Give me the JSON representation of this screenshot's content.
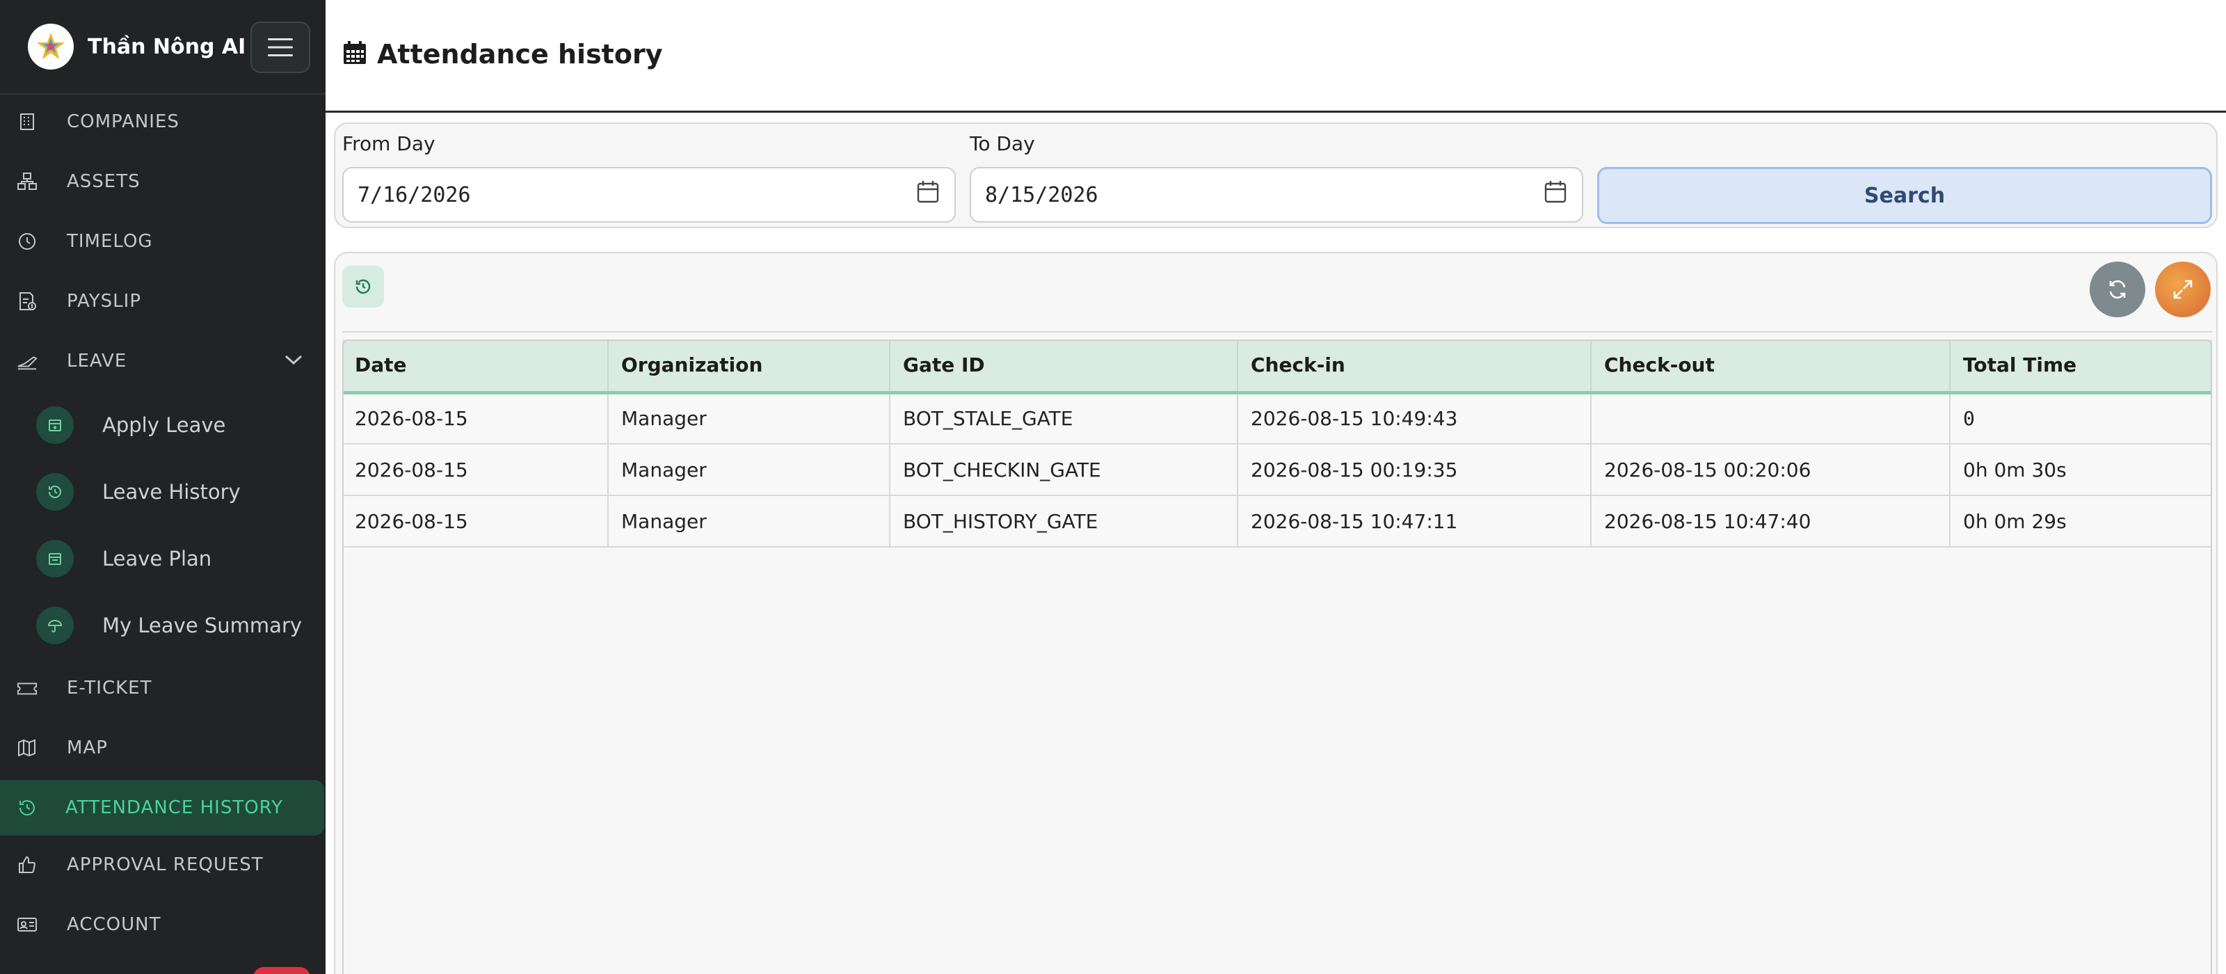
{
  "brand": {
    "name": "Thần Nông AI"
  },
  "sidebar": {
    "items": [
      {
        "label": "COMPANIES",
        "icon": "building-icon"
      },
      {
        "label": "ASSETS",
        "icon": "assets-icon"
      },
      {
        "label": "TIMELOG",
        "icon": "clock-icon"
      },
      {
        "label": "PAYSLIP",
        "icon": "payslip-icon"
      },
      {
        "label": "LEAVE",
        "icon": "leave-icon"
      },
      {
        "label": "E-TICKET",
        "icon": "ticket-icon"
      },
      {
        "label": "MAP",
        "icon": "map-icon"
      },
      {
        "label": "ATTENDANCE HISTORY",
        "icon": "history-icon"
      },
      {
        "label": "APPROVAL REQUEST",
        "icon": "thumbs-up-icon"
      },
      {
        "label": "ACCOUNT",
        "icon": "id-card-icon"
      }
    ],
    "leave_sub": [
      {
        "label": "Apply Leave",
        "icon": "calendar-plus-icon"
      },
      {
        "label": "Leave History",
        "icon": "history-icon"
      },
      {
        "label": "Leave Plan",
        "icon": "calendar-icon"
      },
      {
        "label": "My Leave Summary",
        "icon": "umbrella-icon"
      }
    ],
    "active_color": "#4ad39a"
  },
  "header": {
    "title": "Attendance history",
    "icon": "calendar-grid-icon"
  },
  "filters": {
    "from_label": "From Day",
    "from_value": "7/16/2026",
    "to_label": "To Day",
    "to_value": "8/15/2026",
    "search_label": "Search"
  },
  "table": {
    "columns": [
      "Date",
      "Organization",
      "Gate ID",
      "Check-in",
      "Check-out",
      "Total Time"
    ],
    "rows": [
      [
        "2026-08-15",
        "Manager",
        "BOT_STALE_GATE",
        "2026-08-15 10:49:43",
        "",
        "0"
      ],
      [
        "2026-08-15",
        "Manager",
        "BOT_CHECKIN_GATE",
        "2026-08-15 00:19:35",
        "2026-08-15 00:20:06",
        "0h 0m 30s"
      ],
      [
        "2026-08-15",
        "Manager",
        "BOT_HISTORY_GATE",
        "2026-08-15 10:47:11",
        "2026-08-15 10:47:40",
        "0h 0m 29s"
      ]
    ]
  }
}
